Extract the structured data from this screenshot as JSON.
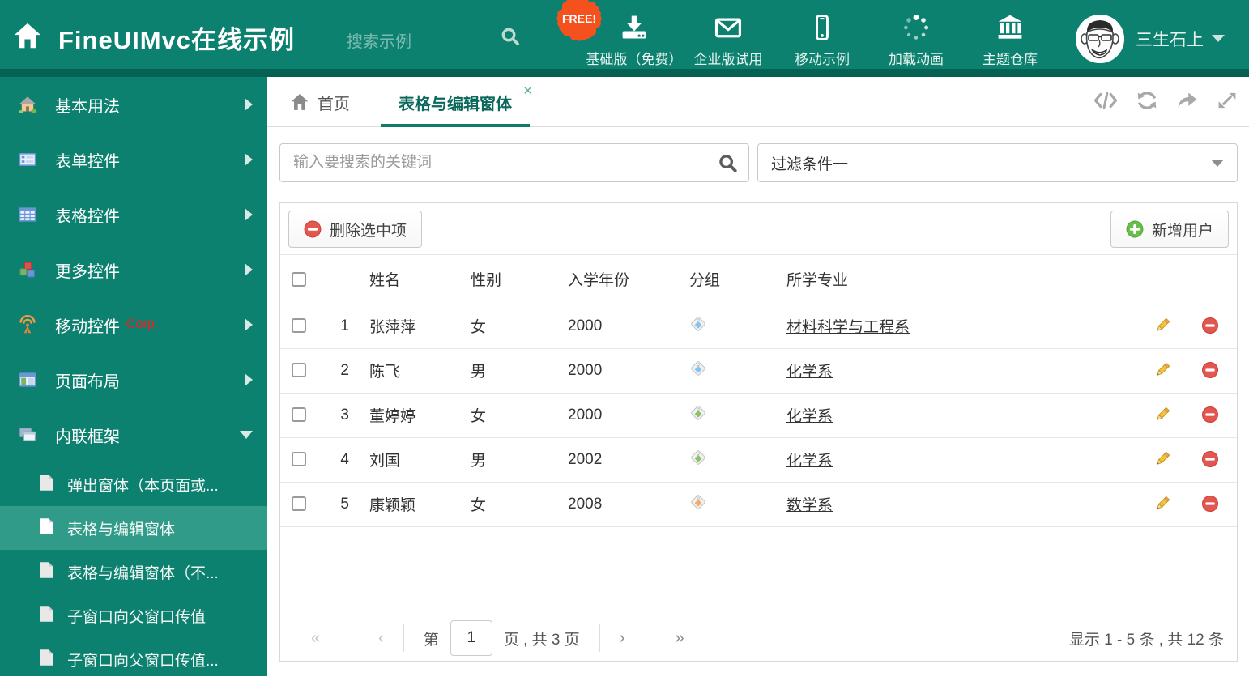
{
  "colors": {
    "teal": "#0d8170",
    "teal_dark": "#056152",
    "sidebar_active": "#2f9b88",
    "tab_accent": "#0d7c6b",
    "free_badge": "#f4511e",
    "danger_red": "#e25750",
    "success_green": "#6abf4b",
    "pencil_gold": "#f0c040",
    "link_color": "#333333"
  },
  "header": {
    "title": "FineUIMvc在线示例",
    "search_placeholder": "搜索示例",
    "badge": "FREE!",
    "nav": [
      {
        "label": "基础版（免费）",
        "icon": "download-icon"
      },
      {
        "label": "企业版试用",
        "icon": "mail-icon"
      },
      {
        "label": "移动示例",
        "icon": "mobile-icon"
      },
      {
        "label": "加载动画",
        "icon": "spinner-icon"
      },
      {
        "label": "主题仓库",
        "icon": "bank-icon"
      }
    ],
    "user": {
      "name": "三生石上"
    }
  },
  "sidebar": {
    "items": [
      {
        "label": "基本用法",
        "icon": "house-icon"
      },
      {
        "label": "表单控件",
        "icon": "form-icon"
      },
      {
        "label": "表格控件",
        "icon": "table-icon"
      },
      {
        "label": "更多控件",
        "icon": "cubes-icon"
      },
      {
        "label": "移动控件",
        "badge": "Corp.",
        "icon": "antenna-icon"
      },
      {
        "label": "页面布局",
        "icon": "layout-icon"
      },
      {
        "label": "内联框架",
        "icon": "frames-icon",
        "expanded": true
      }
    ],
    "subitems": [
      {
        "label": "弹出窗体（本页面或..."
      },
      {
        "label": "表格与编辑窗体",
        "active": true
      },
      {
        "label": "表格与编辑窗体（不..."
      },
      {
        "label": "子窗口向父窗口传值"
      },
      {
        "label": "子窗口向父窗口传值..."
      }
    ]
  },
  "tabs": {
    "home_label": "首页",
    "active_label": "表格与编辑窗体",
    "close": "✕"
  },
  "filters": {
    "keyword_placeholder": "输入要搜索的关键词",
    "filter_value": "过滤条件一"
  },
  "toolbar": {
    "delete_label": "删除选中项",
    "add_label": "新增用户"
  },
  "table": {
    "columns": [
      "姓名",
      "性别",
      "入学年份",
      "分组",
      "所学专业"
    ],
    "rows": [
      {
        "index": "1",
        "name": "张萍萍",
        "gender": "女",
        "year": "2000",
        "tag_color": "#85c3f0",
        "major": "材料科学与工程系"
      },
      {
        "index": "2",
        "name": "陈飞",
        "gender": "男",
        "year": "2000",
        "tag_color": "#85c3f0",
        "major": "化学系"
      },
      {
        "index": "3",
        "name": "董婷婷",
        "gender": "女",
        "year": "2000",
        "tag_color": "#8cc166",
        "major": "化学系"
      },
      {
        "index": "4",
        "name": "刘国",
        "gender": "男",
        "year": "2002",
        "tag_color": "#8cc166",
        "major": "化学系"
      },
      {
        "index": "5",
        "name": "康颖颖",
        "gender": "女",
        "year": "2008",
        "tag_color": "#f5ab62",
        "major": "数学系"
      }
    ]
  },
  "pagination": {
    "first": "«",
    "prev": "‹",
    "next": "›",
    "last": "»",
    "prefix": "第",
    "page": "1",
    "suffix": "页 , 共 3 页",
    "summary": "显示 1 - 5 条 , 共 12 条"
  }
}
